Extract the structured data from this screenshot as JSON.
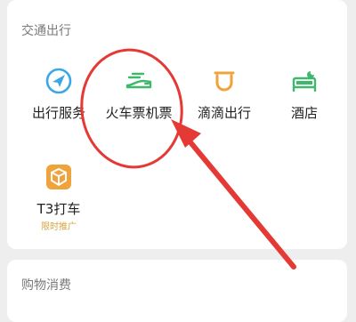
{
  "transport": {
    "title": "交通出行",
    "items": [
      {
        "label": "出行服务",
        "icon": "compass-navigation-icon",
        "color": "#3ba8e6"
      },
      {
        "label": "火车票机票",
        "icon": "train-icon",
        "color": "#3fb76c"
      },
      {
        "label": "滴滴出行",
        "icon": "didi-icon",
        "color": "#f0a33a"
      },
      {
        "label": "酒店",
        "icon": "bed-icon",
        "color": "#3fb76c"
      },
      {
        "label": "T3打车",
        "icon": "t3-box-icon",
        "sub": "限时推广",
        "color": "#f0a33a"
      }
    ]
  },
  "shopping": {
    "title": "购物消费"
  },
  "annotation": {
    "color": "#e53935"
  }
}
